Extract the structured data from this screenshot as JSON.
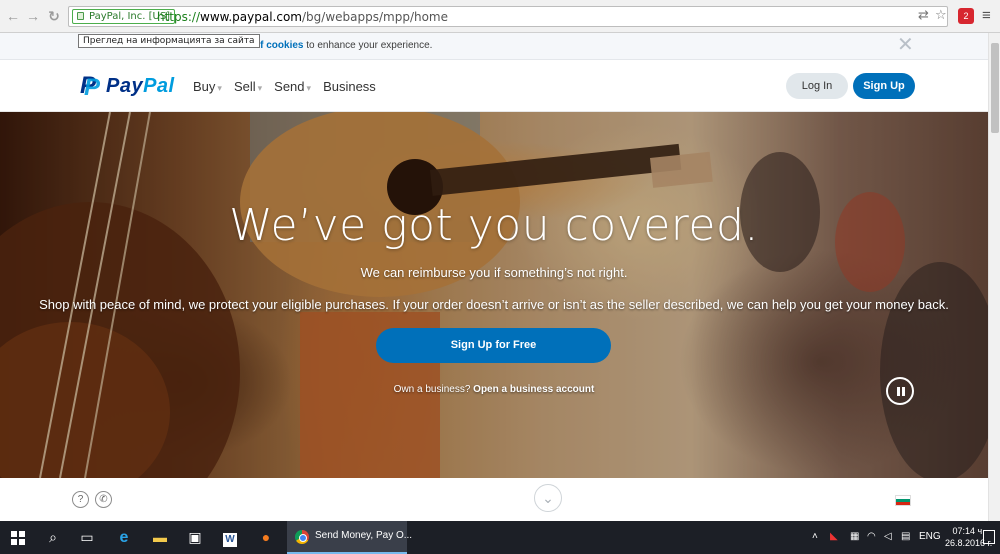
{
  "browser": {
    "back_icon": "back-arrow-icon",
    "forward_icon": "forward-arrow-icon",
    "reload_icon": "reload-icon",
    "ev_label": "PayPal, Inc. [US]",
    "url_scheme": "https://",
    "url_host": "www.paypal.com",
    "url_path": "/bg/webapps/mpp/home",
    "site_info_tooltip": "Преглед на информацията за сайта"
  },
  "cookie_banner": {
    "link_text": "use of cookies",
    "text_after": " to enhance your experience."
  },
  "header": {
    "logo_prefix": "Pay",
    "logo_suffix": "Pal",
    "nav": [
      {
        "label": "Buy"
      },
      {
        "label": "Sell"
      },
      {
        "label": "Send"
      },
      {
        "label": "Business"
      }
    ],
    "login_label": "Log In",
    "signup_label": "Sign Up"
  },
  "hero": {
    "title": "We’ve got you covered.",
    "subtitle": "We can reimburse you if something’s not right.",
    "description": "Shop with peace of mind, we protect your eligible purchases. If your order doesn’t arrive or isn’t as the seller described, we can help you get your money back.",
    "cta_label": "Sign Up for Free",
    "business_prompt": "Own a business?",
    "business_link": "Open a business account"
  },
  "footer": {
    "help_glyph": "?",
    "phone_glyph": "✆",
    "down_glyph": "⌄"
  },
  "taskbar": {
    "chrome_task_label": "Send Money, Pay O...",
    "language": "ENG",
    "time": "07:14 ч.",
    "date": "26.8.2016 г."
  },
  "colors": {
    "paypal_blue": "#0070ba",
    "paypal_navy": "#003087",
    "paypal_light_blue": "#009cde"
  }
}
